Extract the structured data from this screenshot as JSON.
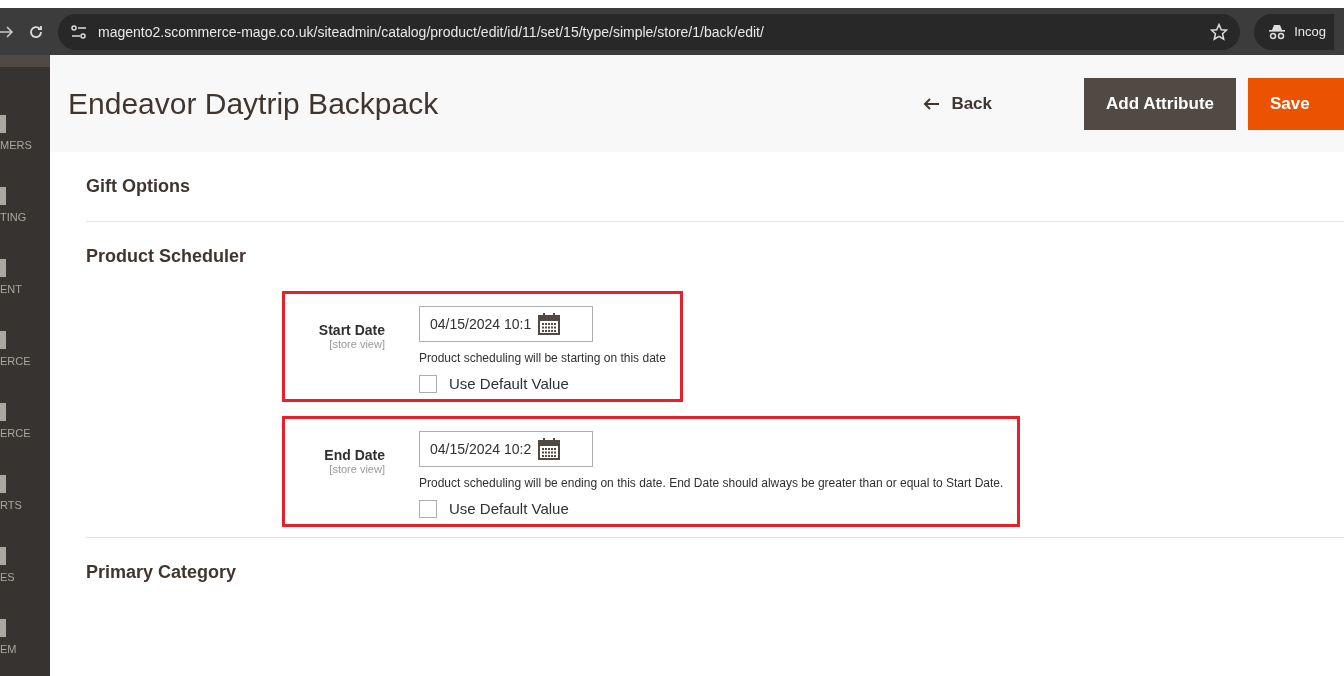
{
  "browser": {
    "url": "magento2.scommerce-mage.co.uk/siteadmin/catalog/product/edit/id/11/set/15/type/simple/store/1/back/edit/",
    "profile": "Incog"
  },
  "sidebar": {
    "items": [
      {
        "label": "MERS"
      },
      {
        "label": "TING"
      },
      {
        "label": "ENT"
      },
      {
        "label": "ERCE"
      },
      {
        "label": "ERCE"
      },
      {
        "label": "RTS"
      },
      {
        "label": "ES"
      },
      {
        "label": "EM"
      }
    ]
  },
  "page": {
    "title": "Endeavor Daytrip Backpack",
    "back": "Back",
    "buttons": [
      {
        "label": "Add Attribute",
        "kind": "secondary"
      },
      {
        "label": "Save",
        "kind": "primary"
      }
    ]
  },
  "sections": [
    {
      "title": "Gift Options"
    },
    {
      "title": "Product Scheduler",
      "fields": [
        {
          "label": "Start Date",
          "scope": "[store view]",
          "value": "04/15/2024 10:1",
          "note": "Product scheduling will be starting on this date",
          "checkbox": "Use Default Value",
          "checked": false,
          "highlighted": true
        },
        {
          "label": "End Date",
          "scope": "[store view]",
          "value": "04/15/2024 10:2",
          "note": "Product scheduling will be ending on this date. End Date should always be greater than or equal to Start Date.",
          "checkbox": "Use Default Value",
          "checked": false,
          "highlighted": true
        }
      ]
    },
    {
      "title": "Primary Category"
    }
  ]
}
